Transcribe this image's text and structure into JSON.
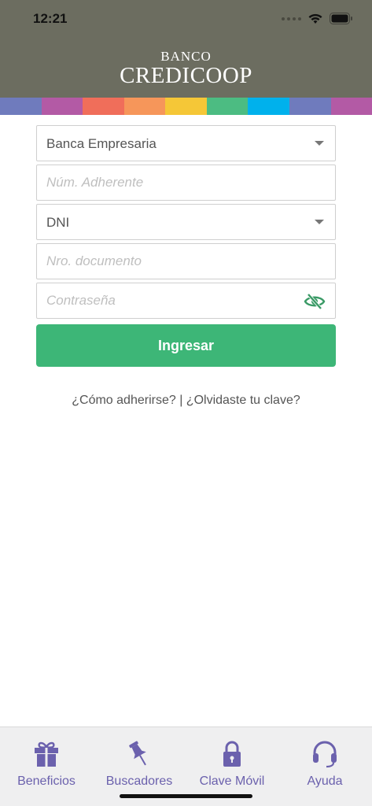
{
  "status_bar": {
    "time": "12:21"
  },
  "header": {
    "brand_top": "BANCO",
    "brand_main": "CREDICOOP"
  },
  "colors": {
    "header_bg": "#6c6d60",
    "accent_green": "#3db677",
    "tab_purple": "#6b61ad",
    "band": [
      "#6f7bbd",
      "#b35aa5",
      "#f06e5a",
      "#f6965a",
      "#f5c737",
      "#4cbc82",
      "#00b1ec",
      "#6f7bbd",
      "#b35aa5"
    ]
  },
  "form": {
    "account_type": {
      "value": "Banca Empresaria"
    },
    "adherent_number": {
      "placeholder": "Núm. Adherente"
    },
    "document_type": {
      "value": "DNI"
    },
    "document_number": {
      "placeholder": "Nro. documento"
    },
    "password": {
      "placeholder": "Contraseña"
    },
    "submit_label": "Ingresar"
  },
  "links": {
    "how_to_join": "¿Cómo adherirse?",
    "separator": " | ",
    "forgot_password": "¿Olvidaste tu clave?"
  },
  "tabbar": {
    "items": [
      {
        "label": "Beneficios",
        "icon": "gift-icon"
      },
      {
        "label": "Buscadores",
        "icon": "pushpin-icon"
      },
      {
        "label": "Clave Móvil",
        "icon": "lock-icon"
      },
      {
        "label": "Ayuda",
        "icon": "headset-icon"
      }
    ]
  }
}
